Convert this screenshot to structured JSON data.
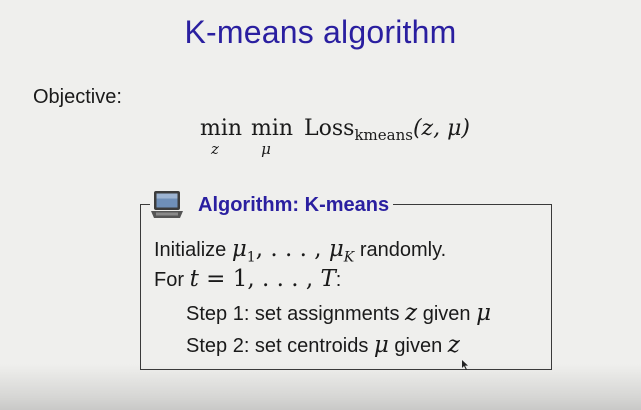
{
  "slide": {
    "title": "K-means algorithm",
    "objective_label": "Objective:"
  },
  "objective_formula": {
    "op1": "min",
    "op1_var": "z",
    "op2": "min",
    "op2_var": "μ",
    "loss": "Loss",
    "loss_subscript": "kmeans",
    "args": "(z, μ)"
  },
  "algorithm": {
    "icon": "laptop-icon",
    "title": "Algorithm: K-means",
    "init": {
      "prefix": "Initialize",
      "mu": "μ",
      "sub1": "1",
      "dots": ", . . . ,",
      "subK": "K",
      "suffix": "randomly."
    },
    "loop": {
      "prefix": "For",
      "t": "t",
      "range": "= 1, . . . ,",
      "T": "T",
      "colon": ":"
    },
    "step1": {
      "text": "Step 1: set assignments",
      "var": "z",
      "given": "given",
      "var2": "μ"
    },
    "step2": {
      "text": "Step 2: set centroids",
      "var": "μ",
      "given": "given",
      "var2": "z"
    }
  },
  "colors": {
    "accent": "#2a1fa0",
    "background": "#efefed",
    "text": "#1a1a1a"
  }
}
